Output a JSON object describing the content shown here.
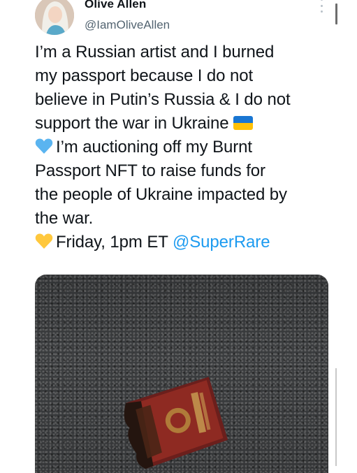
{
  "tweet": {
    "author_name": "Olive Allen",
    "author_handle": "@IamOliveAllen",
    "lines": [
      "I’m a Russian artist and I burned",
      "my passport because I do not",
      "believe in Putin’s Russia & I do not",
      "support the war in Ukraine",
      "I’m auctioning off my Burnt",
      "Passport NFT to raise funds for",
      "the people of Ukraine impacted by",
      "the war.",
      "Friday, 1pm ET"
    ],
    "mention": "@SuperRare",
    "emojis": [
      "ukraine-flag-emoji",
      "blue-heart-emoji",
      "yellow-heart-emoji"
    ],
    "colors": {
      "mention": "#1d9bf0",
      "handle": "#536471",
      "blue_heart": "#5ab4f0",
      "yellow_heart": "#ffc83d"
    },
    "photo": {
      "subject": "burnt-russian-passport-on-asphalt"
    }
  }
}
